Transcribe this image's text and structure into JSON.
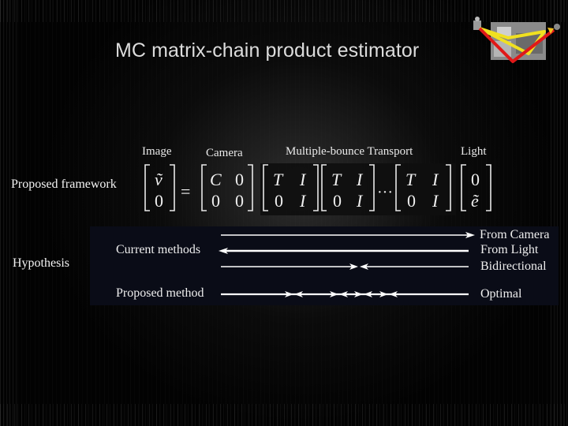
{
  "slide": {
    "title": "MC matrix-chain product estimator",
    "thumbnail_icon": "light-path-diagram-icon"
  },
  "framework": {
    "row_label": "Proposed framework",
    "captions": {
      "image": "Image",
      "camera": "Camera",
      "transport": "Multiple-bounce Transport",
      "light": "Light"
    },
    "image_vector": [
      "ṽ",
      "0"
    ],
    "equals": "=",
    "camera_matrix": [
      [
        "C",
        "0"
      ],
      [
        "0",
        "0"
      ]
    ],
    "transport_matrix": [
      [
        "T",
        "I"
      ],
      [
        "0",
        "I"
      ]
    ],
    "ellipsis": "···",
    "light_vector": [
      "0",
      "ẽ"
    ]
  },
  "hypothesis": {
    "row_label": "Hypothesis",
    "current_label": "Current methods",
    "proposed_label": "Proposed method",
    "rows": [
      {
        "name": "From Camera",
        "direction": "right"
      },
      {
        "name": "From Light",
        "direction": "left"
      },
      {
        "name": "Bidirectional",
        "direction": "meet"
      },
      {
        "name": "Optimal",
        "direction": "multi-meet"
      }
    ]
  },
  "colors": {
    "path_red": "#e01818",
    "path_yellow": "#f0e020",
    "hyp_box_bg": "#0a0c17",
    "text": "#f2f2f2"
  }
}
